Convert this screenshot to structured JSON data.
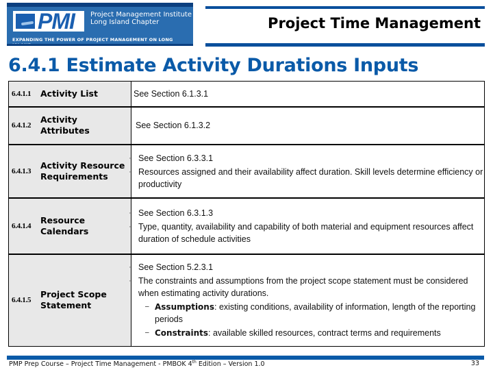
{
  "header": {
    "logo": {
      "mark": "PMI",
      "org_line1": "Project Management Institute",
      "org_line2": "Long Island Chapter",
      "tagline": "Expanding the Power of Project Management on Long Island"
    },
    "chapter_title": "Project Time Management"
  },
  "slide_title": "6.4.1 Estimate Activity Durations Inputs",
  "rows": [
    {
      "number": "6.4.1.1",
      "name": "Activity List",
      "text": "See Section 6.1.3.1"
    },
    {
      "number": "6.4.1.2",
      "name": "Activity Attributes",
      "text": "See Section 6.1.3.2"
    },
    {
      "number": "6.4.1.3",
      "name": "Activity Resource Requirements",
      "bullets": [
        "See Section 6.3.3.1",
        "Resources assigned and their availability affect duration. Skill levels determine efficiency or productivity"
      ]
    },
    {
      "number": "6.4.1.4",
      "name": "Resource Calendars",
      "bullets": [
        "See Section 6.3.1.3",
        "Type, quantity, availability and capability of both material and equipment resources affect duration of schedule activities"
      ]
    },
    {
      "number": "6.4.1.5",
      "name": "Project Scope Statement",
      "bullets": [
        "See Section 5.2.3.1",
        "The constraints and assumptions from the project scope statement must be considered when estimating activity durations."
      ],
      "sub_bullets": [
        {
          "term": "Assumptions",
          "text": ": existing conditions, availability of information, length of the reporting periods"
        },
        {
          "term": "Constraints",
          "text": ": available skilled resources, contract terms and requirements"
        }
      ]
    }
  ],
  "footer": {
    "text_before_sup": "PMP Prep Course – Project Time Management - PMBOK 4",
    "sup": "th",
    "text_after_sup": " Edition – Version 1.0",
    "page_number": "33"
  },
  "colors": {
    "brand_blue": "#0a5aa8",
    "label_cell_bg": "#e8e8e8"
  }
}
